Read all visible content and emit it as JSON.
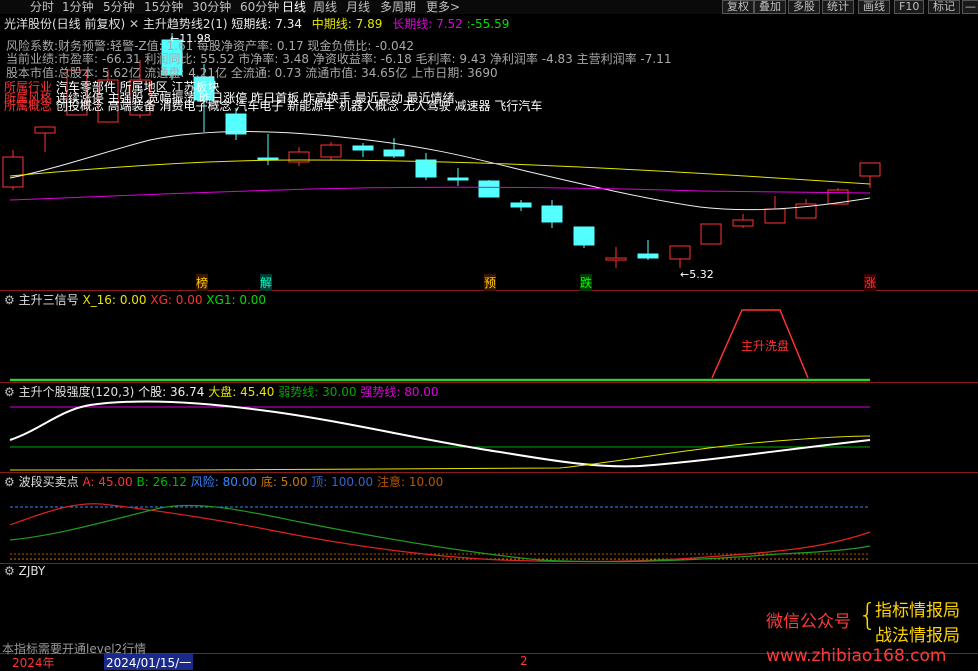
{
  "toolbar": {
    "left_items": [
      "分时",
      "1分钟",
      "5分钟",
      "15分钟",
      "30分钟",
      "60分钟",
      "日线",
      "周线",
      "月线",
      "多周期",
      "更多>"
    ],
    "right_items": [
      "复权",
      "叠加",
      "多股",
      "统计",
      "画线",
      "F10",
      "标记",
      "—"
    ]
  },
  "main": {
    "stock_title": "光洋股份(日线 前复权)",
    "indicator_name": "主升趋势线2(1)",
    "short_label": "短期线:",
    "short_value": "7.34",
    "mid_label": "中期线:",
    "mid_value": "7.89",
    "long_label": "长期线:",
    "long_value": "7.52",
    "extra_value": ":-55.59",
    "high_marker": "←11.98",
    "low_marker": "←5.32",
    "info_lines": [
      "风险系数:财务预警:轻警-Z值: 1.61 每股净资产率: 0.17 现金负债比: -0.042",
      "当前业绩:市盈率: -66.31 利润同比: 55.52 市净率: 3.48 净资收益率: -6.18 毛利率: 9.43 净利润率 -4.83 主营利润率 -7.11",
      "股本市值:总股本: 5.62亿 流通盘: 4.21亿 全流通: 0.73 流通市值: 34.65亿 上市日期: 3690"
    ],
    "tag_labels": [
      "所属行业",
      "所属风格",
      "所属概念"
    ],
    "industry_text": "汽车零部件 所属地区 江苏板块",
    "style_text": "连续涨停 主强股 宽幅振荡 昨日涨停 昨日首板 昨高换手 最近异动 最近情绪",
    "concept_text": "创投概念 高端装备 消费电子概念 汽车电子 新能源车 机器人概念 无人驾驶 减速器 飞行汽车",
    "signals": [
      {
        "text": "榜",
        "color": "#ffcc00"
      },
      {
        "text": "解",
        "color": "#00ffcc"
      },
      {
        "text": "预",
        "color": "#ffcc00"
      },
      {
        "text": "跌",
        "color": "#00ff00"
      },
      {
        "text": "涨",
        "color": "#ff3333"
      }
    ]
  },
  "panel2": {
    "title": "主升三信号",
    "x16_label": "X_16:",
    "x16_value": "0.00",
    "xg_label": "XG:",
    "xg_value": "0.00",
    "xg1_label": "XG1:",
    "xg1_value": "0.00",
    "annotation": "主升洗盘"
  },
  "panel3": {
    "title": "主升个股强度(120,3)",
    "stock_label": "个股:",
    "stock_value": "36.74",
    "market_label": "大盘:",
    "market_value": "45.40",
    "weak_label": "弱势线:",
    "weak_value": "30.00",
    "strong_label": "强势线:",
    "strong_value": "80.00"
  },
  "panel4": {
    "title": "波段买卖点",
    "a_label": "A:",
    "a_value": "45.00",
    "b_label": "B:",
    "b_value": "26.12",
    "risk_label": "风险:",
    "risk_value": "80.00",
    "bottom_label": "底:",
    "bottom_value": "5.00",
    "top_label": "顶:",
    "top_value": "100.00",
    "attention_label": "注意:",
    "attention_value": "10.00"
  },
  "panel5": {
    "title": "ZJBY",
    "level2_note": "本指标需要开通level2行情"
  },
  "watermark": {
    "wechat": "微信公众号",
    "line1": "指标情报局",
    "line2": "战法情报局",
    "site": "www.zhibiao168.com"
  },
  "status_bar": {
    "year": "2024年",
    "date": "2024/01/15/一",
    "number": "2"
  },
  "colors": {
    "up": "#ff3333",
    "down": "#54ffff",
    "short_line": "#f0f0f0",
    "mid_line": "#e6e600",
    "long_line": "#e000e0",
    "separator": "#8b1a1a"
  }
}
